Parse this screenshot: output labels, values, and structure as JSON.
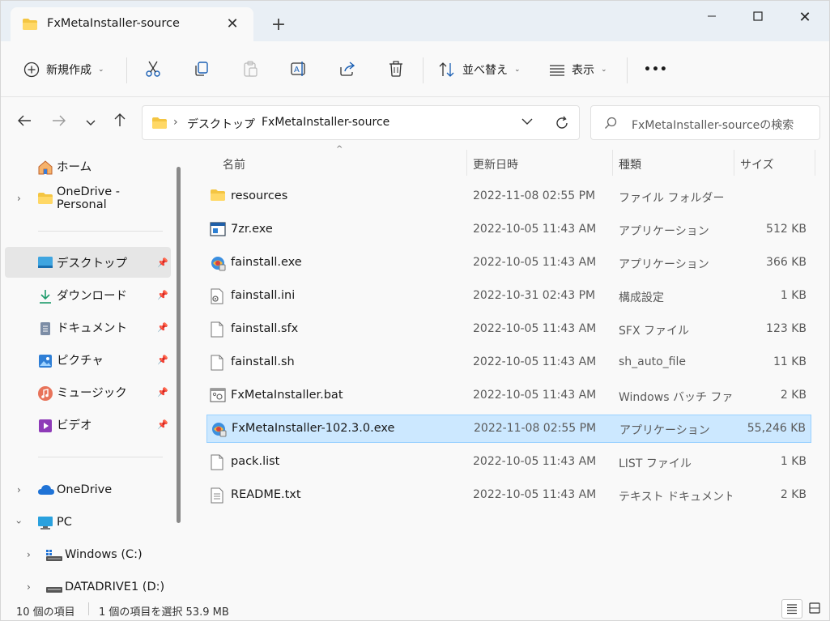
{
  "tab": {
    "title": "FxMetaInstaller-source"
  },
  "window": {
    "minimize_glyph": "—",
    "close_glyph": "✕"
  },
  "toolbar": {
    "new_label": "新規作成",
    "sort_label": "並べ替え",
    "view_label": "表示",
    "more_label": "•••"
  },
  "address": {
    "crumbs": [
      "デスクトップ",
      "FxMetaInstaller-source"
    ]
  },
  "search": {
    "placeholder": "FxMetaInstaller-sourceの検索"
  },
  "sidebar": {
    "home": "ホーム",
    "onedrive_personal": "OneDrive - Personal",
    "quick": [
      "デスクトップ",
      "ダウンロード",
      "ドキュメント",
      "ピクチャ",
      "ミュージック",
      "ビデオ"
    ],
    "onedrive": "OneDrive",
    "pc": "PC",
    "drive_c": "Windows  (C:)",
    "drive_d": "DATADRIVE1 (D:)"
  },
  "columns": {
    "name": "名前",
    "date": "更新日時",
    "type": "種類",
    "size": "サイズ"
  },
  "files": [
    {
      "name": "resources",
      "date": "2022-11-08 02:55 PM",
      "type": "ファイル フォルダー",
      "size": "",
      "icon": "folder-icon"
    },
    {
      "name": "7zr.exe",
      "date": "2022-10-05 11:43 AM",
      "type": "アプリケーション",
      "size": "512 KB",
      "icon": "exe-window-icon"
    },
    {
      "name": "fainstall.exe",
      "date": "2022-10-05 11:43 AM",
      "type": "アプリケーション",
      "size": "366 KB",
      "icon": "installer-icon"
    },
    {
      "name": "fainstall.ini",
      "date": "2022-10-31 02:43 PM",
      "type": "構成設定",
      "size": "1 KB",
      "icon": "settings-file-icon"
    },
    {
      "name": "fainstall.sfx",
      "date": "2022-10-05 11:43 AM",
      "type": "SFX ファイル",
      "size": "123 KB",
      "icon": "file-icon"
    },
    {
      "name": "fainstall.sh",
      "date": "2022-10-05 11:43 AM",
      "type": "sh_auto_file",
      "size": "11 KB",
      "icon": "file-icon"
    },
    {
      "name": "FxMetaInstaller.bat",
      "date": "2022-10-05 11:43 AM",
      "type": "Windows バッチ ファ...",
      "size": "2 KB",
      "icon": "batch-file-icon"
    },
    {
      "name": "FxMetaInstaller-102.3.0.exe",
      "date": "2022-11-08 02:55 PM",
      "type": "アプリケーション",
      "size": "55,246 KB",
      "icon": "installer-icon",
      "selected": true
    },
    {
      "name": "pack.list",
      "date": "2022-10-05 11:43 AM",
      "type": "LIST ファイル",
      "size": "1 KB",
      "icon": "file-icon"
    },
    {
      "name": "README.txt",
      "date": "2022-10-05 11:43 AM",
      "type": "テキスト ドキュメント",
      "size": "2 KB",
      "icon": "text-file-icon"
    }
  ],
  "status": {
    "count": "10 個の項目",
    "selection": "1 個の項目を選択  53.9 MB"
  },
  "colors": {
    "selection_bg": "#cce8ff",
    "selection_border": "#99d1ff",
    "folder": "#f4c542",
    "accent": "#0067c0"
  }
}
